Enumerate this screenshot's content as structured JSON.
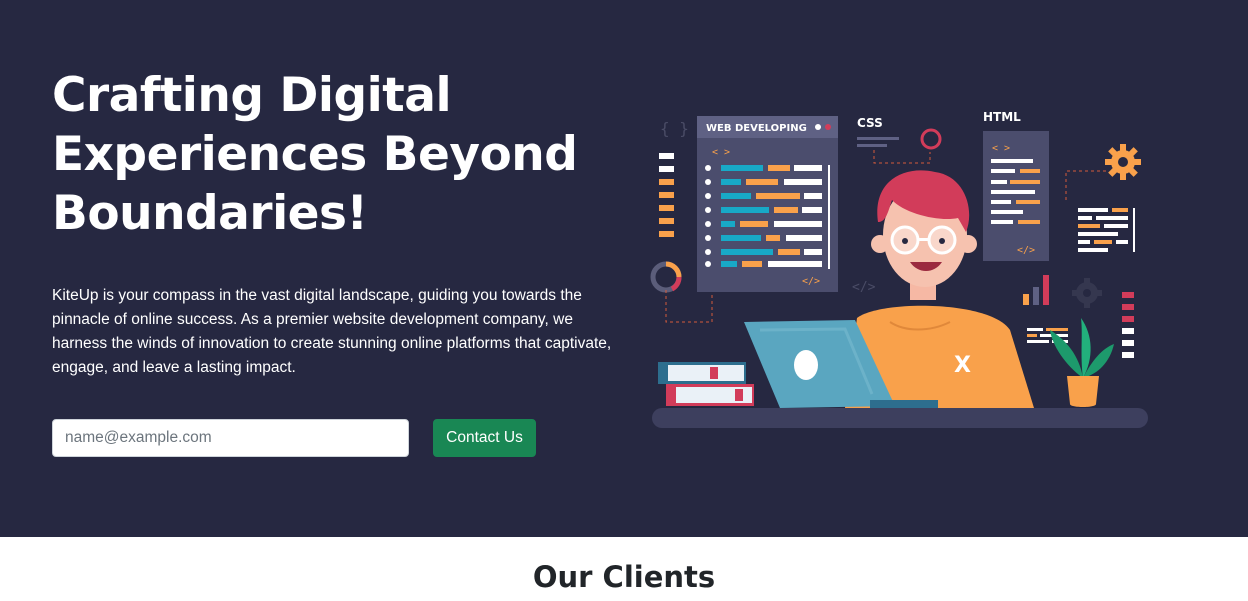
{
  "hero": {
    "title": "Crafting Digital Experiences Beyond Boundaries!",
    "description": "KiteUp is your compass in the vast digital landscape, guiding you towards the pinnacle of online success. As a premier website development company, we harness the winds of innovation to create stunning online platforms that captivate, engage, and leave a lasting impact.",
    "email_placeholder": "name@example.com",
    "email_value": "",
    "contact_label": "Contact Us",
    "colors": {
      "background": "#262841",
      "button": "#198754"
    }
  },
  "illustration": {
    "web_panel_title": "WEB DEVELOPING",
    "css_label": "CSS",
    "html_label": "HTML",
    "code_tag_open": "< >",
    "code_tag_close": "</>",
    "braces": "{ }",
    "shirt_mark": "X"
  },
  "clients": {
    "title": "Our Clients"
  }
}
